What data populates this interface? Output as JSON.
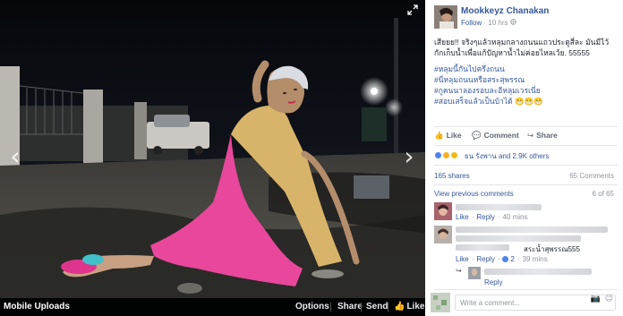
{
  "viewer": {
    "album_label": "Mobile Uploads",
    "actions": {
      "options": "Options",
      "share": "Share",
      "send": "Send",
      "like": "Like"
    },
    "like_icon_glyph": "👍",
    "prev_glyph": "‹",
    "next_glyph": "›"
  },
  "post": {
    "author": "Mookkeyz Chanakan",
    "follow_label": "Follow",
    "meta_sep": "·",
    "time": "10 hrs",
    "caption": "เสียยย!! จริงๆแล้วหลุมกลางถนนแถวประตูสี่ละ มันมีไว้กักเก็บน้ำเพื่อแก้ปัญหาน้ำไม่ค่อยไหลเว้ย. 55555",
    "hashtags": [
      "#หลุมนี้กันไปครึ่งถนน",
      "#นี่หลุมถนนหรือสระสุพรรณ",
      "#กูคนนาลองรอบละอีหลุมเวรเนี่ย",
      "#สอบเสร็จแล้วเป็นบ้าได้ 😁😁😁"
    ],
    "actions": {
      "like": "Like",
      "comment": "Comment",
      "share": "Share"
    },
    "reactions_text": "ธน รังพาน and 2.9K others",
    "shares": "165 shares",
    "comments_count": "65 Comments",
    "view_previous": "View previous comments",
    "comment_progress": "6 of 65"
  },
  "comments": [
    {
      "like": "Like",
      "reply": "Reply",
      "time": "40 mins"
    },
    {
      "mention": "สระน้ำสุพรรณ555",
      "like": "Like",
      "reply": "Reply",
      "reply_count": "2",
      "time": "39 mins"
    }
  ],
  "reply_row": {
    "reply": "Reply"
  },
  "composer": {
    "placeholder": "Write a comment..."
  },
  "colors": {
    "link": "#365899",
    "muted": "#90949c",
    "text": "#1d2129",
    "bar": "#000000"
  }
}
